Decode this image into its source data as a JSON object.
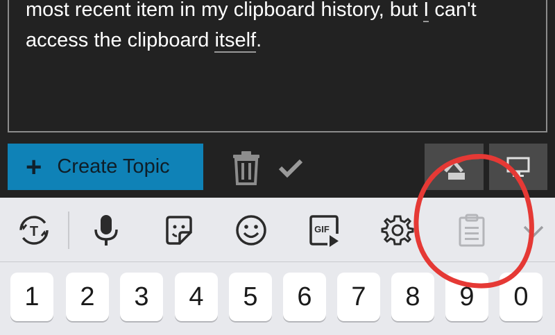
{
  "editor": {
    "line1": "most recent item in my clipboard history, but ",
    "line1_underlined": "I",
    "line1_end": " can't",
    "line2_start": "access the clipboard ",
    "line2_underlined": "itself",
    "line2_end": "."
  },
  "composer": {
    "create_topic_label": "Create Topic",
    "create_topic_icon": "plus-icon",
    "trash_icon": "trash-icon",
    "check_icon": "check-icon",
    "toggle_icon": "chevron-up-icon",
    "preview_icon": "desktop-icon"
  },
  "keyboard": {
    "toolbar_icons": [
      "translate-icon",
      "microphone-icon",
      "sticker-icon",
      "emoji-icon",
      "gif-icon",
      "settings-icon",
      "clipboard-icon",
      "collapse-chevron-icon"
    ],
    "gif_label": "GIF",
    "number_keys": [
      "1",
      "2",
      "3",
      "4",
      "5",
      "6",
      "7",
      "8",
      "9",
      "0"
    ]
  },
  "colors": {
    "editor_bg": "#222222",
    "accent_blue": "#0f82b7",
    "keyboard_bg": "#e8e9ed",
    "annotation_red": "#e53935"
  }
}
